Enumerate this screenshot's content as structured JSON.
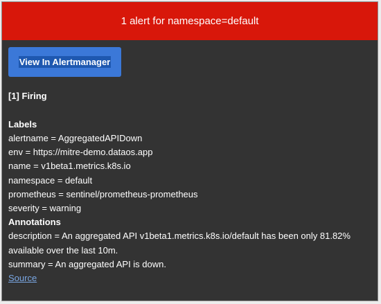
{
  "header": {
    "title": "1 alert for namespace=default",
    "color": "#d8170a"
  },
  "actions": {
    "view_button_label": "View In Alertmanager",
    "button_color": "#3b78d8"
  },
  "alert": {
    "status": "[1] Firing",
    "labels_title": "Labels",
    "labels": [
      "alertname = AggregatedAPIDown",
      "env = https://mitre-demo.dataos.app",
      "name = v1beta1.metrics.k8s.io",
      "namespace = default",
      "prometheus = sentinel/prometheus-prometheus",
      "severity = warning"
    ],
    "annotations_title": "Annotations",
    "annotations": [
      "description = An aggregated API v1beta1.metrics.k8s.io/default has been only 81.82% available over the last 10m.",
      "summary = An aggregated API is down."
    ],
    "source_label": "Source"
  }
}
